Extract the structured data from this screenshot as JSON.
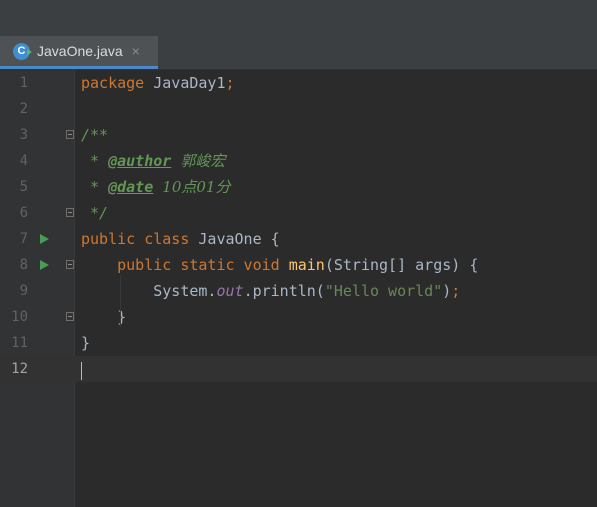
{
  "editor_tab": {
    "icon_letter": "C",
    "filename": "JavaOne.java",
    "close_glyph": "×"
  },
  "code": {
    "line_numbers": [
      "1",
      "2",
      "3",
      "4",
      "5",
      "6",
      "7",
      "8",
      "9",
      "10",
      "11",
      "12"
    ],
    "current_line": 12,
    "run_gutter_lines": [
      7,
      8
    ],
    "fold_gutter_lines": [
      3,
      6,
      8,
      10
    ],
    "line1": {
      "keyword": "package",
      "name": " JavaDay1",
      "semicolon": ";"
    },
    "line3": {
      "doc_open": "/**"
    },
    "line4": {
      "prefix": " * ",
      "tag": "@author",
      "space": " ",
      "value": "郭峻宏"
    },
    "line5": {
      "prefix": " * ",
      "tag": "@date",
      "space": " ",
      "value": "10点01分"
    },
    "line6": {
      "doc_close": " */"
    },
    "line7": {
      "kw1": "public",
      "kw2": " class",
      "name": " JavaOne {"
    },
    "line8": {
      "indent": "    ",
      "kw1": "public",
      "kw2": " static",
      "kw3": " void",
      "method": " main",
      "params": "(String[] args) {"
    },
    "line9": {
      "indent": "        ",
      "system": "System.",
      "field": "out",
      "call": ".println(",
      "string": "\"Hello world\"",
      "close": ")",
      "semicolon": ";"
    },
    "line10": {
      "text": "    }"
    },
    "line11": {
      "text": "}"
    }
  },
  "colors": {
    "background": "#2b2b2b",
    "gutter": "#313335",
    "keyword": "#cc7832",
    "doc_comment": "#629755",
    "method": "#ffc66d",
    "static_field": "#9876aa",
    "string": "#6a8759",
    "default_text": "#a9b7c6",
    "run_icon": "#499c54",
    "tab_underline": "#4a88c7"
  },
  "icons": {
    "tab_icon": "java-class-icon",
    "run": "run-gutter-icon",
    "fold": "fold-marker-icon"
  }
}
